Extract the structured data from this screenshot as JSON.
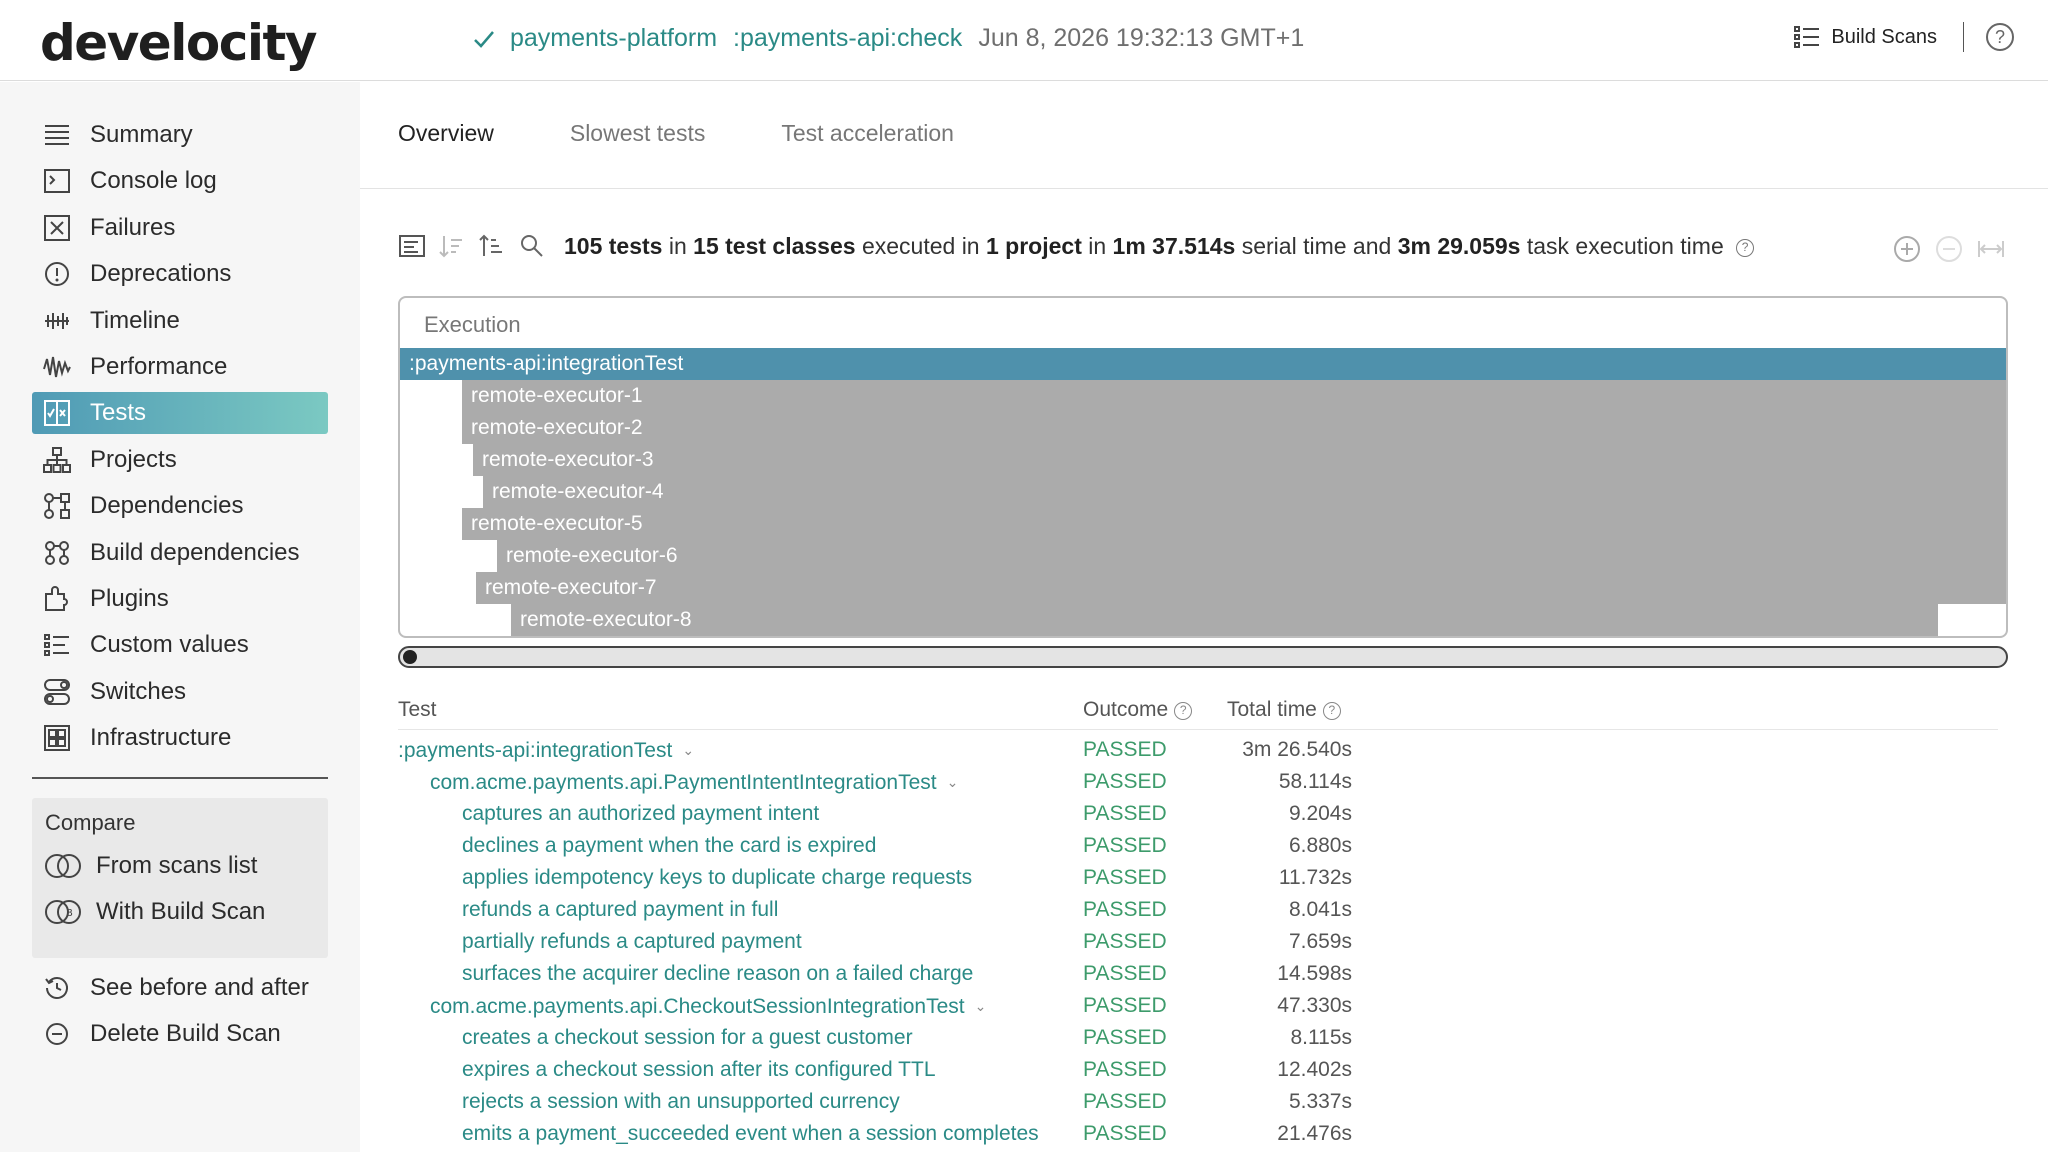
{
  "header": {
    "logo": "develocity",
    "project": "payments-platform",
    "task": ":payments-api:check",
    "timestamp": "Jun 8, 2026 19:32:13 GMT+1",
    "build_scans_label": "Build Scans",
    "help_label": "?"
  },
  "sidebar": {
    "items": [
      {
        "label": "Summary",
        "icon": "summary-icon"
      },
      {
        "label": "Console log",
        "icon": "console-icon"
      },
      {
        "label": "Failures",
        "icon": "failures-icon"
      },
      {
        "label": "Deprecations",
        "icon": "deprecations-icon"
      },
      {
        "label": "Timeline",
        "icon": "timeline-icon"
      },
      {
        "label": "Performance",
        "icon": "performance-icon"
      },
      {
        "label": "Tests",
        "icon": "tests-icon",
        "active": true
      },
      {
        "label": "Projects",
        "icon": "projects-icon"
      },
      {
        "label": "Dependencies",
        "icon": "dependencies-icon"
      },
      {
        "label": "Build dependencies",
        "icon": "build-dependencies-icon"
      },
      {
        "label": "Plugins",
        "icon": "plugins-icon"
      },
      {
        "label": "Custom values",
        "icon": "custom-values-icon"
      },
      {
        "label": "Switches",
        "icon": "switches-icon"
      },
      {
        "label": "Infrastructure",
        "icon": "infrastructure-icon"
      }
    ],
    "compare": {
      "title": "Compare",
      "from_scans": "From scans list",
      "with_scan": "With Build Scan"
    },
    "before_after": "See before and after",
    "delete": "Delete Build Scan"
  },
  "tabs": [
    "Overview",
    "Slowest tests",
    "Test acceleration"
  ],
  "summary": {
    "tests": "105 tests",
    "classes": "15 test classes",
    "project": "1 project",
    "serial_time": "1m 37.514s",
    "task_time": "3m 29.059s",
    "w_in": "in",
    "w_executed_in": "executed in",
    "w_in2": "in",
    "w_serial": "serial time and",
    "w_task": "task execution time"
  },
  "execution": {
    "header": "Execution",
    "rows": [
      ":payments-api:integrationTest",
      "remote-executor-1",
      "remote-executor-2",
      "remote-executor-3",
      "remote-executor-4",
      "remote-executor-5",
      "remote-executor-6",
      "remote-executor-7",
      "remote-executor-8"
    ]
  },
  "table": {
    "col_test": "Test",
    "col_outcome": "Outcome",
    "col_time": "Total time",
    "rows": [
      {
        "name": ":payments-api:integrationTest",
        "level": 0,
        "expand": true,
        "outcome": "PASSED",
        "time": "3m 26.540s"
      },
      {
        "name": "com.acme.payments.api.PaymentIntentIntegrationTest",
        "level": 1,
        "expand": true,
        "outcome": "PASSED",
        "time": "58.114s"
      },
      {
        "name": "captures an authorized payment intent",
        "level": 2,
        "outcome": "PASSED",
        "time": "9.204s"
      },
      {
        "name": "declines a payment when the card is expired",
        "level": 2,
        "outcome": "PASSED",
        "time": "6.880s"
      },
      {
        "name": "applies idempotency keys to duplicate charge requests",
        "level": 2,
        "outcome": "PASSED",
        "time": "11.732s"
      },
      {
        "name": "refunds a captured payment in full",
        "level": 2,
        "outcome": "PASSED",
        "time": "8.041s"
      },
      {
        "name": "partially refunds a captured payment",
        "level": 2,
        "outcome": "PASSED",
        "time": "7.659s"
      },
      {
        "name": "surfaces the acquirer decline reason on a failed charge",
        "level": 2,
        "outcome": "PASSED",
        "time": "14.598s"
      },
      {
        "name": "com.acme.payments.api.CheckoutSessionIntegrationTest",
        "level": 1,
        "expand": true,
        "outcome": "PASSED",
        "time": "47.330s"
      },
      {
        "name": "creates a checkout session for a guest customer",
        "level": 2,
        "outcome": "PASSED",
        "time": "8.115s"
      },
      {
        "name": "expires a checkout session after its configured TTL",
        "level": 2,
        "outcome": "PASSED",
        "time": "12.402s"
      },
      {
        "name": "rejects a session with an unsupported currency",
        "level": 2,
        "outcome": "PASSED",
        "time": "5.337s"
      },
      {
        "name": "emits a payment_succeeded event when a session completes",
        "level": 2,
        "outcome": "PASSED",
        "time": "21.476s"
      }
    ]
  },
  "colors": {
    "accent": "#2a8a86",
    "passed": "#3d9b6b",
    "active_nav_start": "#4f9ab5",
    "active_nav_end": "#7bc9c2",
    "exec_selected": "#4f91ac",
    "exec_bar": "#ababab"
  }
}
